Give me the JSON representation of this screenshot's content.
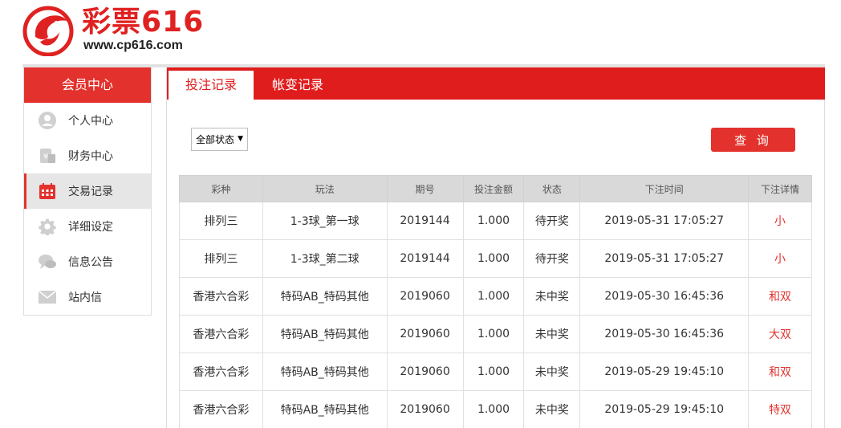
{
  "logo": {
    "name": "彩票616",
    "url": "www.cp616.com"
  },
  "sidebar": {
    "title": "会员中心",
    "items": [
      {
        "label": "个人中心",
        "icon": "user-icon"
      },
      {
        "label": "财务中心",
        "icon": "money-icon"
      },
      {
        "label": "交易记录",
        "icon": "calendar-icon",
        "active": true
      },
      {
        "label": "详细设定",
        "icon": "gear-icon"
      },
      {
        "label": "信息公告",
        "icon": "chat-icon"
      },
      {
        "label": "站内信",
        "icon": "mail-icon"
      }
    ]
  },
  "tabs": [
    {
      "label": "投注记录",
      "active": true
    },
    {
      "label": "帐变记录",
      "active": false
    }
  ],
  "filter": {
    "status_selected": "全部状态"
  },
  "query_button": "查 询",
  "table": {
    "headers": [
      "彩种",
      "玩法",
      "期号",
      "投注金额",
      "状态",
      "下注时间",
      "下注详情"
    ],
    "rows": [
      [
        "排列三",
        "1-3球_第一球",
        "2019144",
        "1.000",
        "待开奖",
        "2019-05-31 17:05:27",
        "小"
      ],
      [
        "排列三",
        "1-3球_第二球",
        "2019144",
        "1.000",
        "待开奖",
        "2019-05-31 17:05:27",
        "小"
      ],
      [
        "香港六合彩",
        "特码AB_特码其他",
        "2019060",
        "1.000",
        "未中奖",
        "2019-05-30 16:45:36",
        "和双"
      ],
      [
        "香港六合彩",
        "特码AB_特码其他",
        "2019060",
        "1.000",
        "未中奖",
        "2019-05-30 16:45:36",
        "大双"
      ],
      [
        "香港六合彩",
        "特码AB_特码其他",
        "2019060",
        "1.000",
        "未中奖",
        "2019-05-29 19:45:10",
        "和双"
      ],
      [
        "香港六合彩",
        "特码AB_特码其他",
        "2019060",
        "1.000",
        "未中奖",
        "2019-05-29 19:45:10",
        "特双"
      ]
    ]
  },
  "colors": {
    "brand_red": "#e3322d",
    "tab_red": "#e01d1d",
    "header_gray": "#d9d9d9"
  }
}
